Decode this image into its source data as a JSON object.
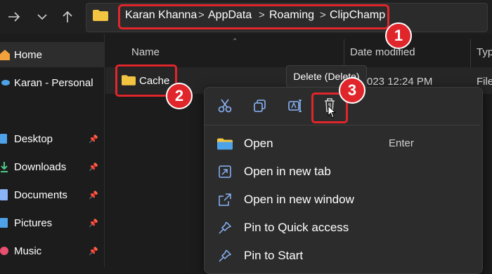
{
  "breadcrumbs": [
    "Karan Khanna",
    "AppData",
    "Roaming",
    "ClipChamp"
  ],
  "breadcrumb_separator": ">",
  "badges": [
    "1",
    "2",
    "3"
  ],
  "nav": {
    "back_icon": "arrow-left",
    "forward_icon": "arrow-right",
    "recent_icon": "chevron-down",
    "up_icon": "arrow-up"
  },
  "sidebar": {
    "items": [
      {
        "label": "Home",
        "icon": "home-icon",
        "pinned": false
      },
      {
        "label": "Karan - Personal",
        "icon": "onedrive-icon",
        "pinned": false
      },
      {
        "label": "Desktop",
        "icon": "desktop-icon",
        "pinned": true
      },
      {
        "label": "Downloads",
        "icon": "download-icon",
        "pinned": true
      },
      {
        "label": "Documents",
        "icon": "documents-icon",
        "pinned": true
      },
      {
        "label": "Pictures",
        "icon": "pictures-icon",
        "pinned": true
      },
      {
        "label": "Music",
        "icon": "music-icon",
        "pinned": true
      }
    ]
  },
  "columns": {
    "name": "Name",
    "date_modified": "Date modified",
    "type": "Typ"
  },
  "rows": [
    {
      "name": "Cache",
      "date": "023 12:24 PM",
      "type": "File"
    }
  ],
  "tooltip": "Delete (Delete)",
  "context_menu": {
    "quick_actions": [
      "cut-icon",
      "copy-icon",
      "rename-icon",
      "delete-icon"
    ],
    "items": [
      {
        "label": "Open",
        "shortcut": "Enter",
        "icon": "folder-icon"
      },
      {
        "label": "Open in new tab",
        "shortcut": "",
        "icon": "new-tab-icon"
      },
      {
        "label": "Open in new window",
        "shortcut": "",
        "icon": "new-window-icon"
      },
      {
        "label": "Pin to Quick access",
        "shortcut": "",
        "icon": "pin-icon"
      },
      {
        "label": "Pin to Start",
        "shortcut": "",
        "icon": "pin-icon"
      }
    ]
  },
  "colors": {
    "background": "#1c1c1c",
    "accent_red": "#e0262b",
    "folder_yellow": "#f3c342",
    "icon_blue": "#4ea3e8"
  }
}
